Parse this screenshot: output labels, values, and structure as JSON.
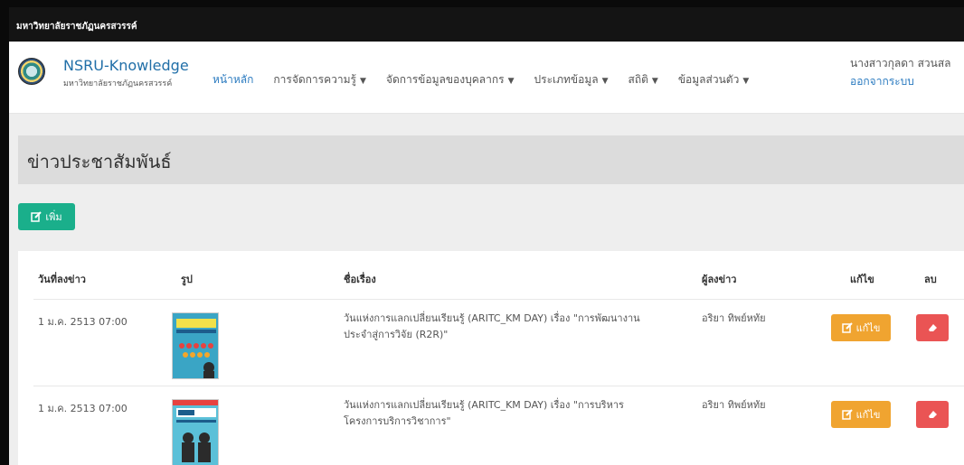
{
  "topbar": {
    "title": "มหาวิทยาลัยราชภัฏนครสวรรค์"
  },
  "brand": {
    "title": "NSRU-Knowledge",
    "subtitle": "มหาวิทยาลัยราชภัฏนครสวรรค์"
  },
  "nav": {
    "home": "หน้าหลัก",
    "items": [
      "การจัดการความรู้",
      "จัดการข้อมูลของบุคลากร",
      "ประเภทข้อมูล",
      "สถิติ",
      "ข้อมูลส่วนตัว"
    ]
  },
  "user": {
    "name": "นางสาวกุลดา สวนสล",
    "logout": "ออกจากระบบ"
  },
  "page": {
    "heading": "ข่าวประชาสัมพันธ์",
    "add_label": "เพิ่ม"
  },
  "table": {
    "headers": [
      "วันที่ลงข่าว",
      "รูป",
      "ชื่อเรื่อง",
      "ผู้ลงข่าว",
      "แก้ไข",
      "ลบ"
    ],
    "rows": [
      {
        "date": "1 ม.ค. 2513 07:00",
        "title_line1": "วันแห่งการแลกเปลี่ยนเรียนรู้ (ARITC_KM DAY) เรื่อง \"การพัฒนางาน",
        "title_line2": "ประจำสู่การวิจัย (R2R)\"",
        "author": "อริยา ทิพย์หทัย",
        "edit_label": "แก้ไข"
      },
      {
        "date": "1 ม.ค. 2513 07:00",
        "title_line1": "วันแห่งการแลกเปลี่ยนเรียนรู้ (ARITC_KM DAY) เรื่อง \"การบริหาร",
        "title_line2": "โครงการบริการวิชาการ\"",
        "author": "อริยา ทิพย์หทัย",
        "edit_label": "แก้ไข"
      }
    ]
  },
  "colors": {
    "primary": "#1aaf8b",
    "warning": "#f0a430",
    "danger": "#ea5454",
    "link": "#2b7bc0"
  },
  "icons": {
    "add": "edit-icon",
    "edit": "edit-icon",
    "delete": "eraser-icon",
    "caret": "caret-down-icon"
  }
}
